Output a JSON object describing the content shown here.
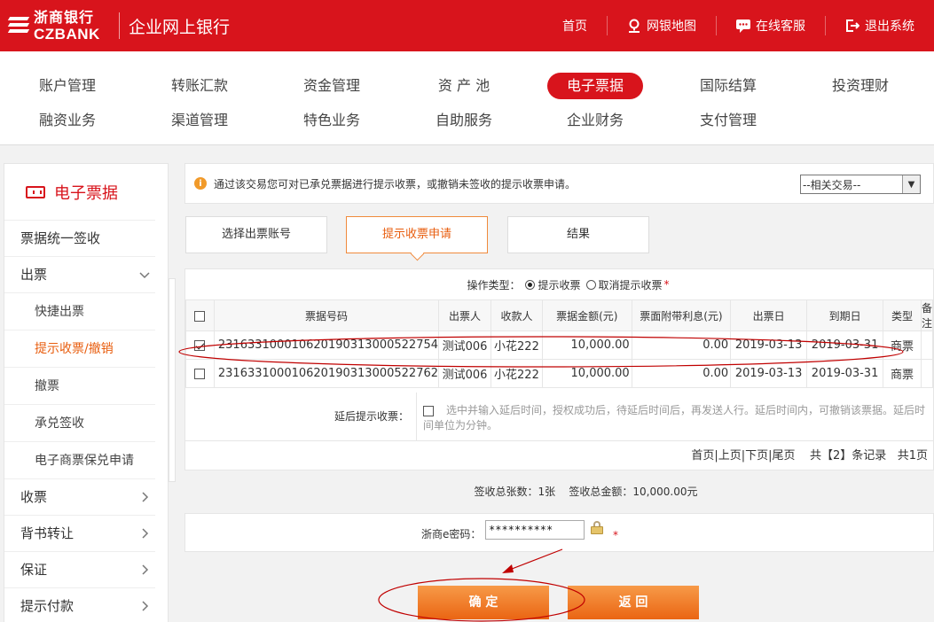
{
  "header": {
    "bank_name_cn": "浙商银行",
    "bank_name_en": "CZBANK",
    "portal_title": "企业网上银行",
    "links": [
      {
        "label": "首页",
        "icon": ""
      },
      {
        "label": "网银地图",
        "icon": "map-pin-icon"
      },
      {
        "label": "在线客服",
        "icon": "chat-icon"
      },
      {
        "label": "退出系统",
        "icon": "logout-icon"
      }
    ]
  },
  "mainmenu": {
    "items": [
      "账户管理",
      "转账汇款",
      "资金管理",
      "资 产 池",
      "电子票据",
      "国际结算",
      "投资理财",
      "融资业务",
      "渠道管理",
      "特色业务",
      "自助服务",
      "企业财务",
      "支付管理"
    ],
    "active": "电子票据"
  },
  "sidebar": {
    "title": "电子票据",
    "items": [
      {
        "label": "票据统一签收"
      },
      {
        "label": "出票",
        "chevron": "∨"
      },
      {
        "label": "快捷出票",
        "sub": true
      },
      {
        "label": "提示收票/撤销",
        "sub": true,
        "active": true
      },
      {
        "label": "撤票",
        "sub": true
      },
      {
        "label": "承兑签收",
        "sub": true
      },
      {
        "label": "电子商票保兑申请",
        "sub": true
      },
      {
        "label": "收票",
        "chevron": "›"
      },
      {
        "label": "背书转让",
        "chevron": "›"
      },
      {
        "label": "保证",
        "chevron": "›"
      },
      {
        "label": "提示付款",
        "chevron": "›"
      }
    ]
  },
  "tip": {
    "text": "通过该交易您可对已承兑票据进行提示收票，或撤销未签收的提示收票申请。",
    "related_select": "--相关交易--"
  },
  "steps": [
    "选择出票账号",
    "提示收票申请",
    "结果"
  ],
  "operation": {
    "label": "操作类型：",
    "options": [
      "提示收票",
      "取消提示收票"
    ],
    "required": "*"
  },
  "table": {
    "headers": [
      "票据号码",
      "出票人",
      "收款人",
      "票据金额(元)",
      "票面附带利息(元)",
      "出票日",
      "到期日",
      "类型",
      "备注"
    ],
    "rows": [
      {
        "checked": true,
        "bill_no": "231633100010620190313000522754",
        "drawer": "测试006",
        "payee": "小花222",
        "amount": "10,000.00",
        "interest": "0.00",
        "issue_date": "2019-03-13",
        "due_date": "2019-03-31",
        "type": "商票",
        "remark": ""
      },
      {
        "checked": false,
        "bill_no": "231633100010620190313000522762",
        "drawer": "测试006",
        "payee": "小花222",
        "amount": "10,000.00",
        "interest": "0.00",
        "issue_date": "2019-03-13",
        "due_date": "2019-03-31",
        "type": "商票",
        "remark": ""
      }
    ]
  },
  "delay": {
    "label": "延后提示收票：",
    "text": "选中并输入延后时间，授权成功后，待延后时间后，再发送人行。延后时间内，可撤销该票据。延后时间单位为分钟。"
  },
  "pager": {
    "links": "首页|上页|下页|尾页",
    "records": "共【2】条记录",
    "pages": "共1页"
  },
  "summary": {
    "count": "签收总张数：1张",
    "total": "签收总金额：10,000.00元"
  },
  "password": {
    "label": "浙商e密码：",
    "value": "**********",
    "required": "*"
  },
  "buttons": {
    "confirm": "确 定",
    "back": "返 回"
  },
  "colors": {
    "brand_red": "#d8141c",
    "accent_orange": "#ea6513"
  }
}
